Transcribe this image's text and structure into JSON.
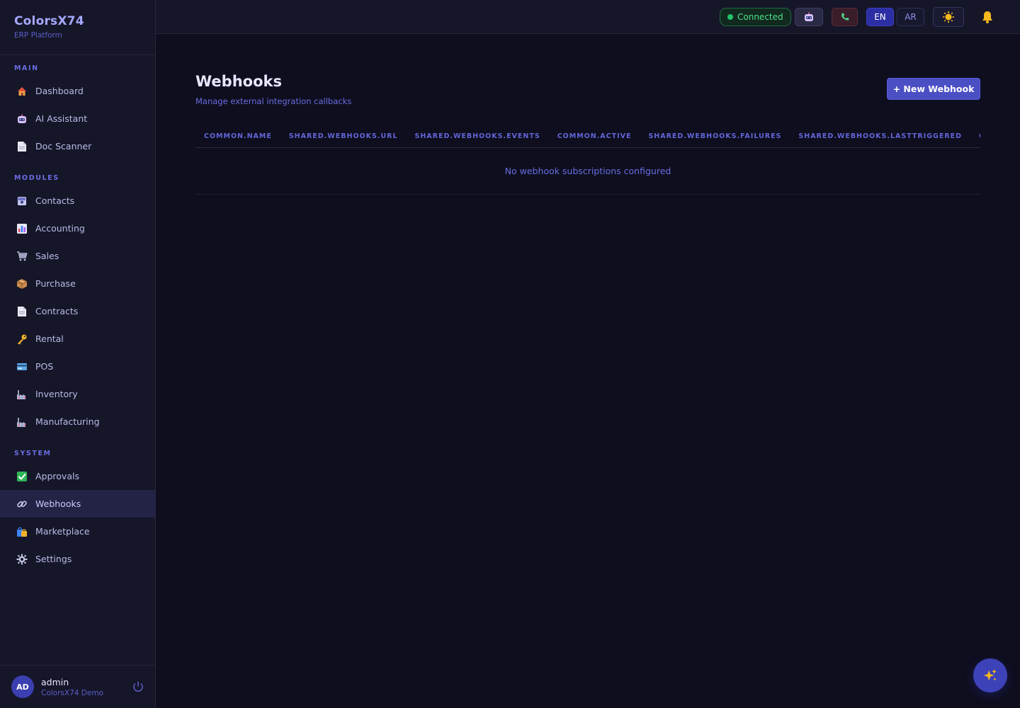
{
  "brand": {
    "name": "ColorsX74",
    "subtitle": "ERP Platform"
  },
  "sidebar": {
    "sections": [
      {
        "label": "MAIN",
        "items": [
          {
            "label": "Dashboard",
            "icon": "house-icon"
          },
          {
            "label": "AI Assistant",
            "icon": "robot-icon"
          },
          {
            "label": "Doc Scanner",
            "icon": "document-icon"
          }
        ]
      },
      {
        "label": "MODULES",
        "items": [
          {
            "label": "Contacts",
            "icon": "contacts-icon"
          },
          {
            "label": "Accounting",
            "icon": "bar-chart-icon"
          },
          {
            "label": "Sales",
            "icon": "cart-icon"
          },
          {
            "label": "Purchase",
            "icon": "package-icon"
          },
          {
            "label": "Contracts",
            "icon": "document-icon"
          },
          {
            "label": "Rental",
            "icon": "key-icon"
          },
          {
            "label": "POS",
            "icon": "credit-card-icon"
          },
          {
            "label": "Inventory",
            "icon": "factory-icon"
          },
          {
            "label": "Manufacturing",
            "icon": "factory-icon"
          }
        ]
      },
      {
        "label": "SYSTEM",
        "items": [
          {
            "label": "Approvals",
            "icon": "checkmark-icon"
          },
          {
            "label": "Webhooks",
            "icon": "link-icon",
            "active": true
          },
          {
            "label": "Marketplace",
            "icon": "shopping-bags-icon"
          },
          {
            "label": "Settings",
            "icon": "gear-icon"
          }
        ]
      }
    ]
  },
  "user": {
    "initials": "AD",
    "name": "admin",
    "org": "ColorsX74 Demo"
  },
  "topbar": {
    "connection_status": "Connected",
    "lang_en": "EN",
    "lang_ar": "AR"
  },
  "page": {
    "title": "Webhooks",
    "subtitle": "Manage external integration callbacks",
    "new_button": "+ New Webhook"
  },
  "table": {
    "columns": [
      "COMMON.NAME",
      "SHARED.WEBHOOKS.URL",
      "SHARED.WEBHOOKS.EVENTS",
      "COMMON.ACTIVE",
      "SHARED.WEBHOOKS.FAILURES",
      "SHARED.WEBHOOKS.LASTTRIGGERED",
      "COMMON.ACTIONS"
    ],
    "empty_message": "No webhook subscriptions configured"
  },
  "colors": {
    "accent": "#4b4fc4",
    "sidebar_bg": "#161629",
    "main_bg": "#0e0e1f",
    "connected": "#4ee08a"
  }
}
